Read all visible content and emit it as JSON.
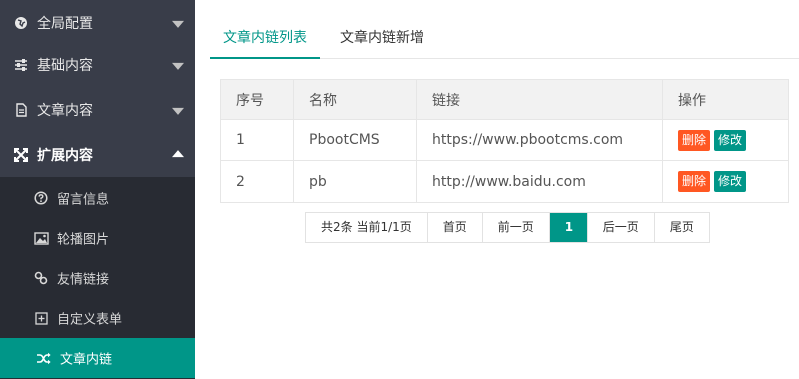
{
  "sidebar": {
    "items": [
      {
        "label": "全局配置",
        "icon": "globe-icon",
        "expanded": false
      },
      {
        "label": "基础内容",
        "icon": "sliders-icon",
        "expanded": false
      },
      {
        "label": "文章内容",
        "icon": "file-text-icon",
        "expanded": false
      },
      {
        "label": "扩展内容",
        "icon": "expand-icon",
        "expanded": true
      }
    ],
    "submenu": [
      {
        "label": "留言信息",
        "icon": "question-circle-icon"
      },
      {
        "label": "轮播图片",
        "icon": "image-icon"
      },
      {
        "label": "友情链接",
        "icon": "link-icon"
      },
      {
        "label": "自定义表单",
        "icon": "plus-square-icon"
      },
      {
        "label": "文章内链",
        "icon": "shuffle-icon",
        "active": true
      }
    ]
  },
  "tabs": [
    {
      "label": "文章内链列表",
      "active": true
    },
    {
      "label": "文章内链新增",
      "active": false
    }
  ],
  "table": {
    "columns": [
      "序号",
      "名称",
      "链接",
      "操作"
    ],
    "rows": [
      {
        "id": "1",
        "name": "PbootCMS",
        "link": "https://www.pbootcms.com"
      },
      {
        "id": "2",
        "name": "pb",
        "link": "http://www.baidu.com"
      }
    ],
    "actions": {
      "delete": "删除",
      "edit": "修改"
    }
  },
  "pager": {
    "summary": "共2条 当前1/1页",
    "first": "首页",
    "prev": "前一页",
    "current": "1",
    "next": "后一页",
    "last": "尾页"
  },
  "colors": {
    "accent": "#009688",
    "danger": "#ff5722",
    "sidebar": "#393d49",
    "submenu": "#282b33"
  }
}
